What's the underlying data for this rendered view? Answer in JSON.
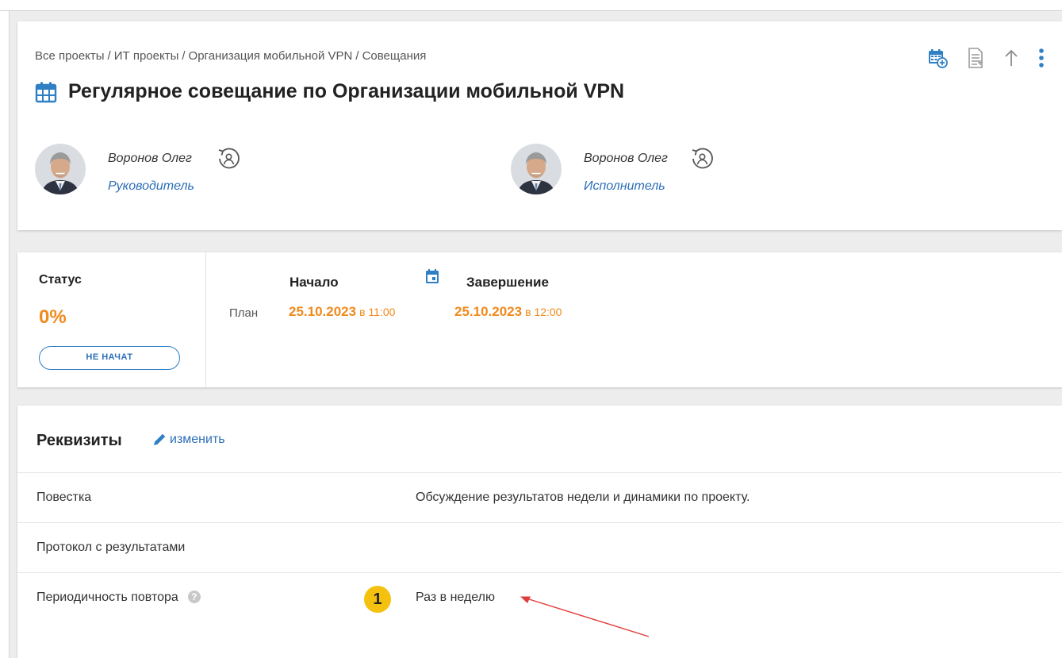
{
  "breadcrumb": [
    "Все проекты",
    "ИТ проекты",
    "Организация мобильной VPN",
    "Совещания"
  ],
  "breadcrumb_separator": "/",
  "title": "Регулярное совещание по Организации мобильной VPN",
  "toolbar_icons": [
    "calendar-add-icon",
    "document-icon",
    "arrow-up-icon",
    "more-vertical-icon"
  ],
  "people": [
    {
      "name": "Воронов Олег",
      "role": "Руководитель"
    },
    {
      "name": "Воронов Олег",
      "role": "Исполнитель"
    }
  ],
  "status": {
    "label": "Статус",
    "percent": "0%",
    "badge": "НЕ НАЧАТ"
  },
  "schedule": {
    "start_label": "Начало",
    "end_label": "Завершение",
    "plan_label": "План",
    "start_date": "25.10.2023",
    "start_time": "в 11:00",
    "end_date": "25.10.2023",
    "end_time": "в 12:00"
  },
  "requisites": {
    "title": "Реквизиты",
    "edit_label": "изменить",
    "rows": [
      {
        "label": "Повестка",
        "value": "Обсуждение результатов недели и динамики по проекту."
      },
      {
        "label": "Протокол с результатами",
        "value": ""
      },
      {
        "label": "Периодичность повтора",
        "value": "Раз в неделю"
      }
    ],
    "help_glyph": "?",
    "marker": "1"
  },
  "colors": {
    "accent": "#2c6fb7",
    "orange": "#f08a1c",
    "marker": "#f4c10e",
    "arrow": "#e23b3b"
  }
}
